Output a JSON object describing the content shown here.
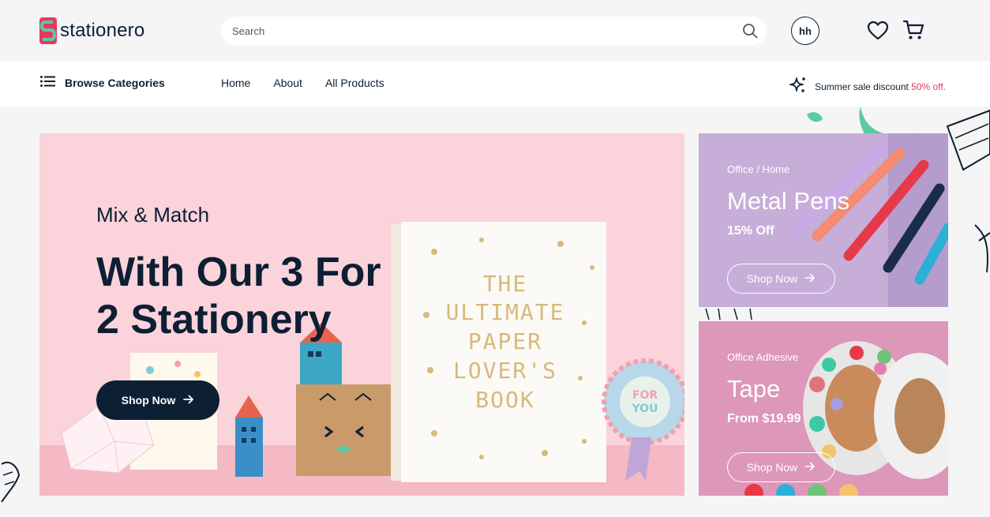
{
  "brand": {
    "name": "stationero",
    "mark_letter": "S"
  },
  "search": {
    "placeholder": "Search"
  },
  "account": {
    "initials": "hh"
  },
  "nav": {
    "browse_label": "Browse Categories",
    "links": [
      "Home",
      "About",
      "All Products"
    ],
    "promo_text": "Summer sale discount",
    "promo_highlight": "50% off."
  },
  "hero": {
    "subtitle": "Mix & Match",
    "title_line1": "With Our 3 For",
    "title_line2": "2 Stationery",
    "cta_label": "Shop Now",
    "book_title": [
      "THE",
      "ULTIMATE",
      "PAPER",
      "LOVER'S",
      "BOOK"
    ],
    "rosette_text": [
      "FOR",
      "YOU"
    ]
  },
  "promos": [
    {
      "category": "Office / Home",
      "title": "Metal Pens",
      "offer": "15% Off",
      "cta_label": "Shop Now"
    },
    {
      "category": "Office Adhesive",
      "title": "Tape",
      "offer": "From $19.99",
      "cta_label": "Shop Now"
    }
  ],
  "colors": {
    "navy": "#0d1f33",
    "accent_pink": "#e8395c",
    "hero_bg": "#fbd3db",
    "pens_bg": "#c6aed8",
    "tape_bg": "#dd97b8",
    "teal": "#5cc9a7"
  },
  "icons": {
    "search": "search-icon",
    "heart": "heart-icon",
    "cart": "cart-icon",
    "menu": "list-icon",
    "sparkle": "sparkle-icon",
    "arrow": "arrow-right-icon"
  }
}
